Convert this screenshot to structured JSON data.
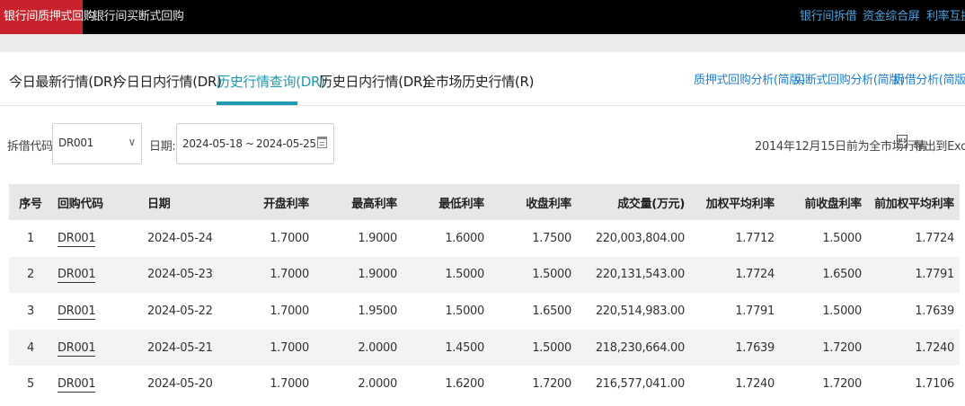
{
  "topbar": {
    "left_items": [
      "银行间质押式回购",
      "银行间买断式回购"
    ],
    "right_items": [
      "银行间拆借",
      "资金综合屏",
      "利率互换"
    ]
  },
  "tabs": {
    "items": [
      "今日最新行情(DR)",
      "今日日内行情(DR)",
      "历史行情查询(DR)",
      "历史日内行情(DR)",
      "全市场历史行情(R)"
    ],
    "active_index": 2,
    "links": [
      "质押式回购分析(简版)",
      "买断式回购分析(简版)",
      "拆借分析(简版)"
    ]
  },
  "filter": {
    "code_label": "拆借代码:",
    "code_value": "DR001",
    "date_label": "日期:",
    "date_from": "2024-05-18",
    "date_sep": "~",
    "date_to": "2024-05-25",
    "note": "2014年12月15日前为全市场行情",
    "export_label": "导出到Excel"
  },
  "table": {
    "headers": [
      "序号",
      "回购代码",
      "日期",
      "开盘利率",
      "最高利率",
      "最低利率",
      "收盘利率",
      "成交量(万元)",
      "加权平均利率",
      "前收盘利率",
      "前加权平均利率"
    ],
    "rows": [
      [
        "1",
        "DR001",
        "2024-05-24",
        "1.7000",
        "1.9000",
        "1.6000",
        "1.7500",
        "220,003,804.00",
        "1.7712",
        "1.5000",
        "1.7724"
      ],
      [
        "2",
        "DR001",
        "2024-05-23",
        "1.7000",
        "1.9000",
        "1.5000",
        "1.5000",
        "220,131,543.00",
        "1.7724",
        "1.6500",
        "1.7791"
      ],
      [
        "3",
        "DR001",
        "2024-05-22",
        "1.7000",
        "1.9500",
        "1.5000",
        "1.6500",
        "220,514,983.00",
        "1.7791",
        "1.5000",
        "1.7639"
      ],
      [
        "4",
        "DR001",
        "2024-05-21",
        "1.7000",
        "2.0000",
        "1.4500",
        "1.5000",
        "218,230,664.00",
        "1.7639",
        "1.7200",
        "1.7240"
      ],
      [
        "5",
        "DR001",
        "2024-05-20",
        "1.7000",
        "2.0000",
        "1.6200",
        "1.7200",
        "216,577,041.00",
        "1.7240",
        "1.7200",
        "1.7106"
      ]
    ]
  },
  "colors": {
    "topbar_bg": "#000000",
    "active_top": "#c8232c",
    "accent": "#1e9ab0",
    "link": "#1e7fd0"
  }
}
